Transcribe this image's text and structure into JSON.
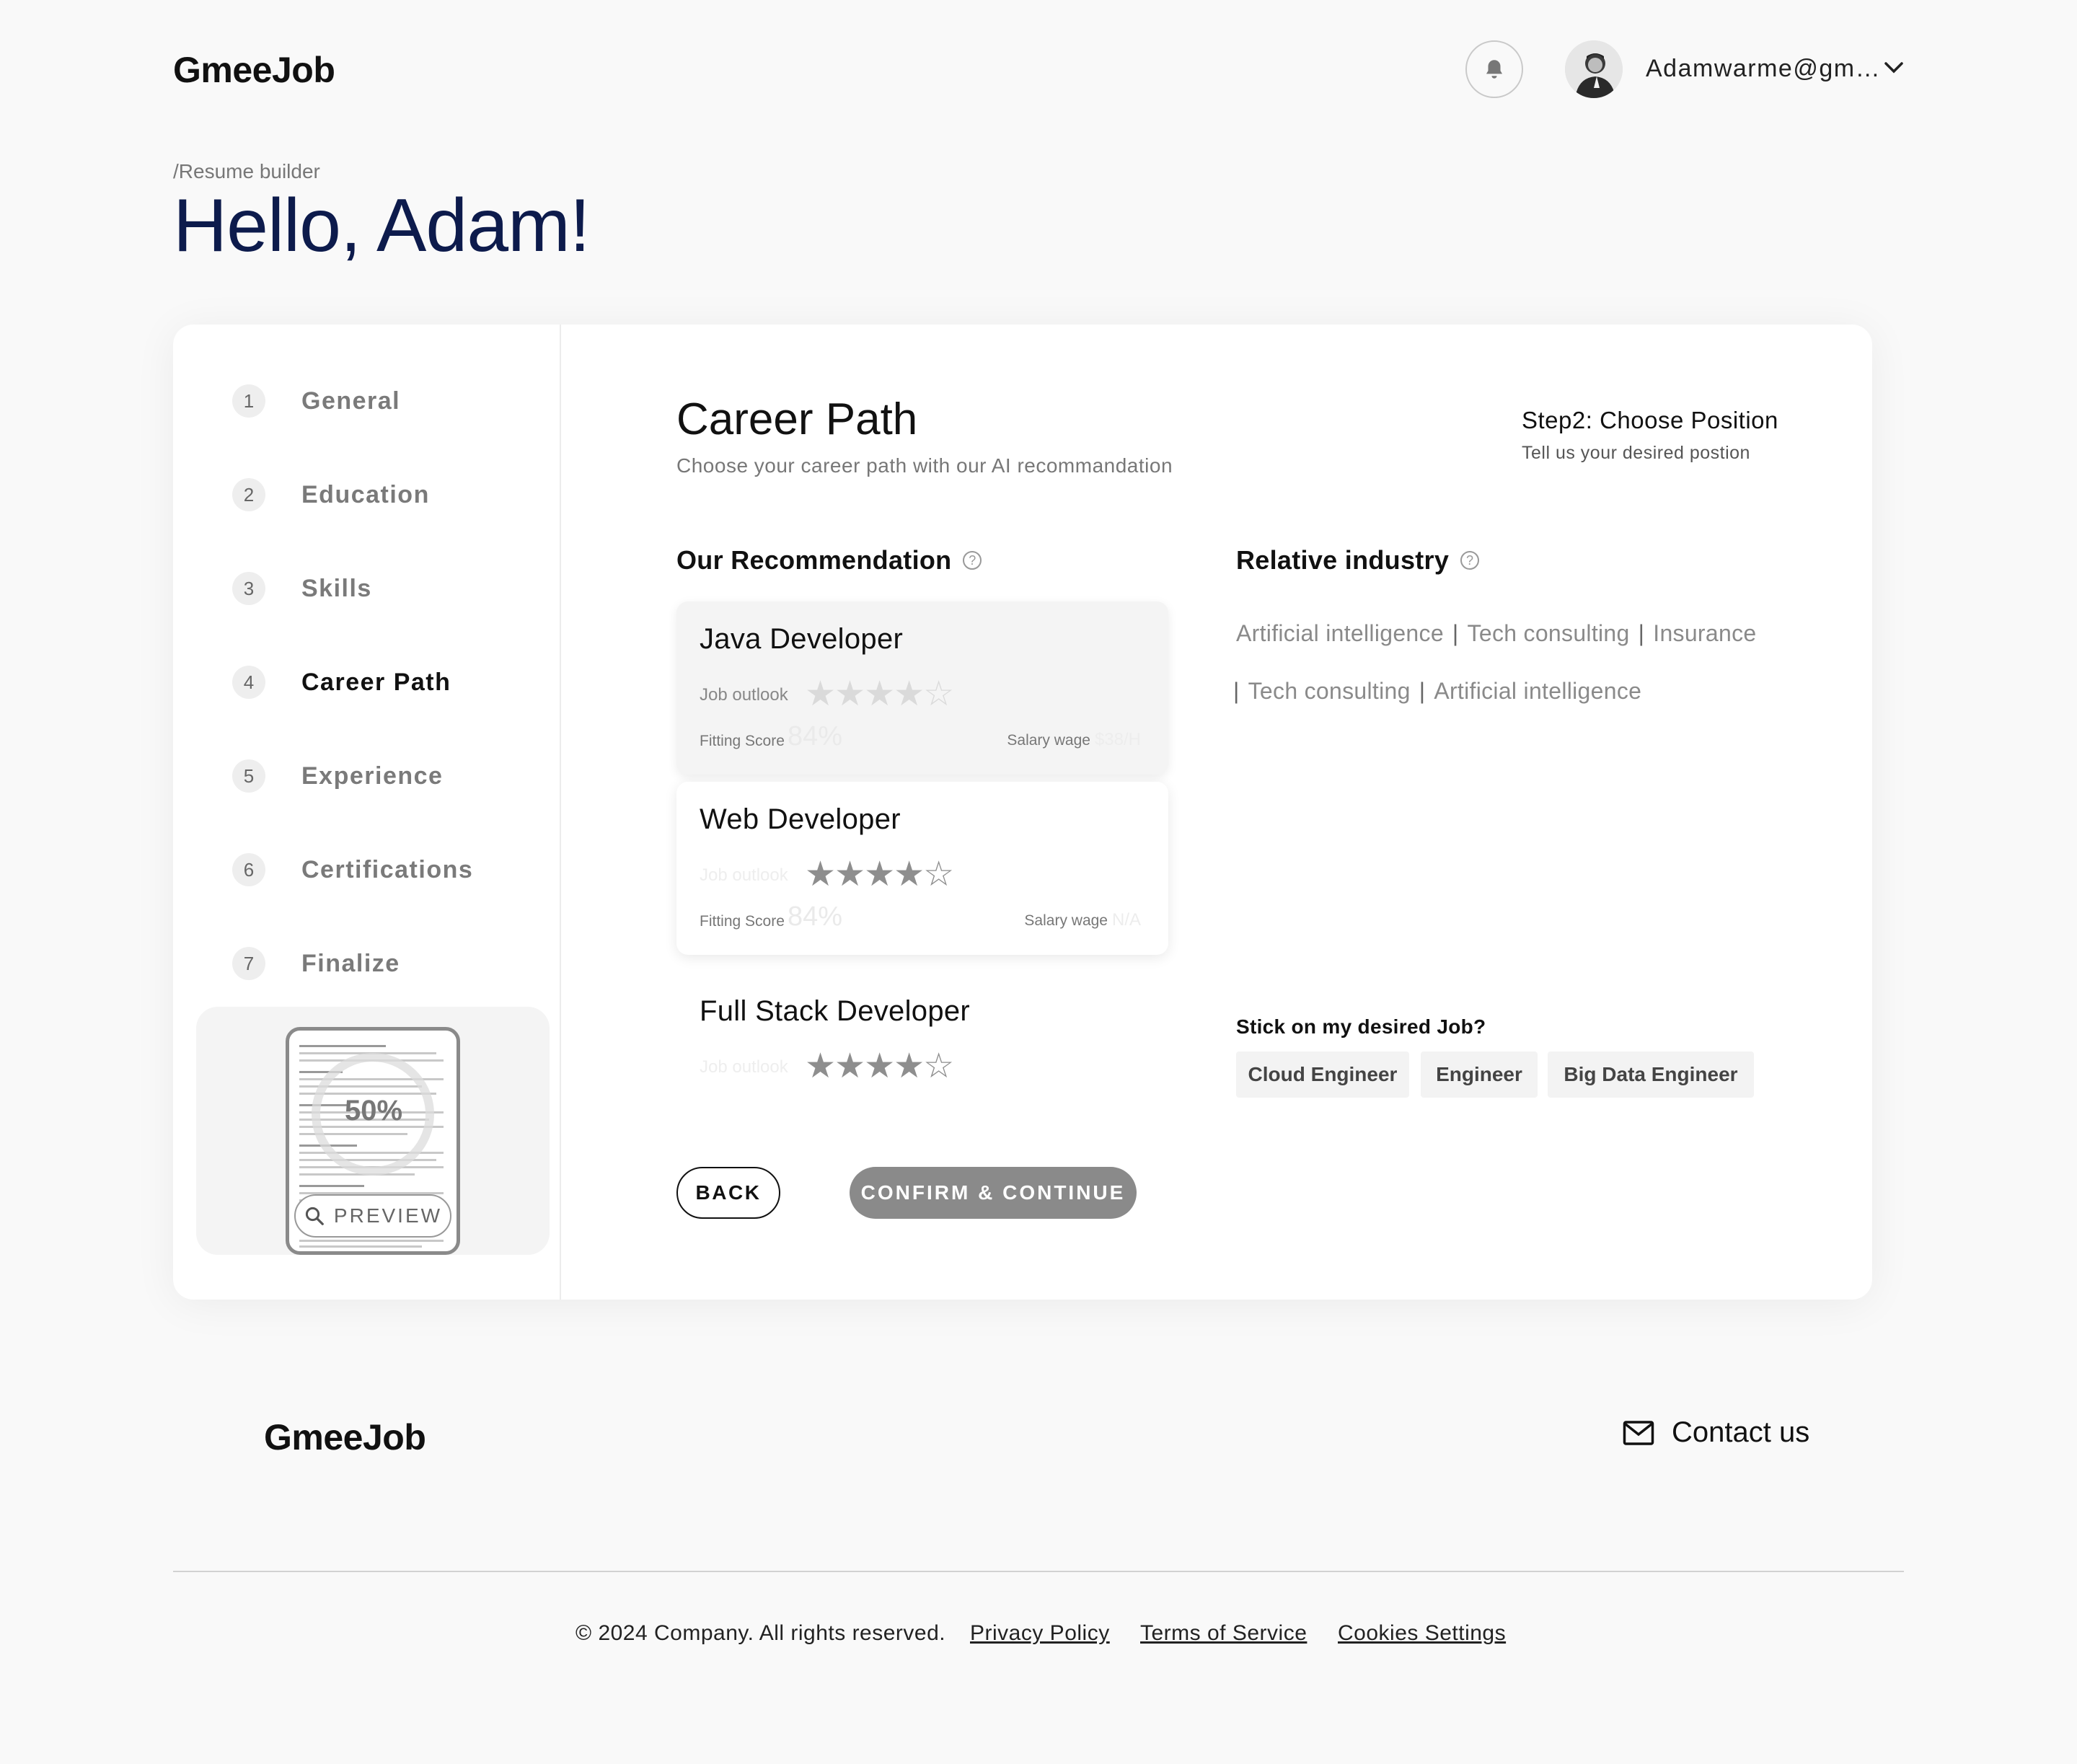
{
  "header": {
    "logo": "GmeeJob",
    "user_email": "Adamwarme@gm…",
    "icons": {
      "notifications": "bell-icon",
      "menu": "chevron-down-icon"
    }
  },
  "page": {
    "breadcrumb": "/Resume builder",
    "greeting": "Hello, Adam!"
  },
  "steps": [
    {
      "num": "1",
      "label": "General"
    },
    {
      "num": "2",
      "label": "Education"
    },
    {
      "num": "3",
      "label": "Skills"
    },
    {
      "num": "4",
      "label": "Career Path",
      "active": true
    },
    {
      "num": "5",
      "label": "Experience"
    },
    {
      "num": "6",
      "label": "Certifications"
    },
    {
      "num": "7",
      "label": "Finalize"
    }
  ],
  "preview": {
    "progress_percent": 50,
    "progress_text": "50%",
    "button_label": "PREVIEW",
    "icon": "search-icon"
  },
  "career": {
    "title": "Career Path",
    "subtitle": "Choose your career path with our AI recommandation",
    "step_title": "Step2: Choose Position",
    "step_subtitle": "Tell us your desired postion"
  },
  "recommendation": {
    "title": "Our Recommendation",
    "help_icon": "question-circle-icon",
    "jobs": [
      {
        "title": "Java Developer",
        "outlook_label": "Job outlook",
        "rating": 4,
        "rating_max": 5,
        "stars_text": "★★★★☆",
        "fit_label": "Fitting Score",
        "fit_value": "84%",
        "salary_label": "Salary wage",
        "salary_value": "$38/H"
      },
      {
        "title": "Web Developer",
        "outlook_label": "Job outlook",
        "rating": 4,
        "rating_max": 5,
        "stars_text": "★★★★☆",
        "fit_label": "Fitting Score",
        "fit_value": "84%",
        "salary_label": "Salary wage",
        "salary_value": "N/A"
      },
      {
        "title": "Full Stack Developer",
        "outlook_label": "Job outlook",
        "rating": 4,
        "rating_max": 5,
        "stars_text": "★★★★☆"
      }
    ]
  },
  "industry": {
    "title": "Relative industry",
    "help_icon": "question-circle-icon",
    "items": [
      "Artificial intelligence",
      "Tech consulting",
      "Insurance",
      "Tech consulting",
      "Artificial intelligence"
    ],
    "separator": "|"
  },
  "desired": {
    "question": "Stick on my desired Job?",
    "chips": [
      "Cloud Engineer",
      "Engineer",
      "Big Data Engineer"
    ]
  },
  "actions": {
    "back": "BACK",
    "confirm": "CONFIRM & CONTINUE"
  },
  "footer": {
    "logo": "GmeeJob",
    "contact": "Contact us",
    "contact_icon": "mail-icon",
    "copyright": "© 2024 Company. All rights reserved.",
    "links": [
      "Privacy Policy",
      "Terms of Service",
      "Cookies Settings"
    ]
  },
  "colors": {
    "heading": "#0d1b4c",
    "background": "#f9f9f9",
    "button_primary": "#8a8a8a"
  }
}
